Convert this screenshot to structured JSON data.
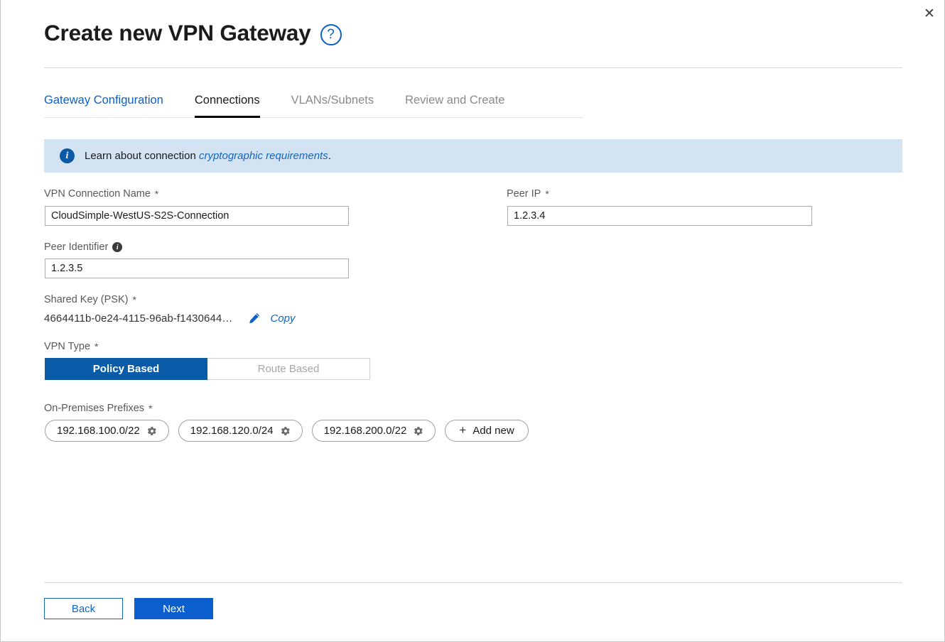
{
  "window": {
    "close_label": "✕"
  },
  "header": {
    "title": "Create new VPN Gateway",
    "help_glyph": "?"
  },
  "tabs": [
    {
      "label": "Gateway Configuration",
      "state": "link"
    },
    {
      "label": "Connections",
      "state": "active"
    },
    {
      "label": "VLANs/Subnets",
      "state": "muted"
    },
    {
      "label": "Review and Create",
      "state": "muted"
    }
  ],
  "banner": {
    "icon": "info-icon",
    "glyph": "i",
    "text": "Learn about connection ",
    "link_text": "cryptographic requirements",
    "trailing": "."
  },
  "form": {
    "connection_name": {
      "label": "VPN Connection Name",
      "required": "*",
      "value": "CloudSimple-WestUS-S2S-Connection",
      "placeholder": ""
    },
    "peer_ip": {
      "label": "Peer IP",
      "required": "*",
      "value": "1.2.3.4",
      "placeholder": ""
    },
    "peer_identifier": {
      "label": "Peer Identifier",
      "info_glyph": "i",
      "value": "1.2.3.5",
      "placeholder": ""
    },
    "shared_key": {
      "label": "Shared Key  (PSK)",
      "required": "*",
      "value": "4664411b-0e24-4115-96ab-f1430644…",
      "edit_icon": "pencil-icon",
      "copy_label": "Copy"
    },
    "vpn_type": {
      "label": "VPN Type",
      "required": "*",
      "options": [
        "Policy Based",
        "Route Based"
      ],
      "selected": "Policy Based"
    },
    "prefixes": {
      "label": "On-Premises Prefixes",
      "required": "*",
      "items": [
        {
          "value": "192.168.100.0/22",
          "icon": "gear-icon"
        },
        {
          "value": "192.168.120.0/24",
          "icon": "gear-icon"
        },
        {
          "value": "192.168.200.0/22",
          "icon": "gear-icon"
        }
      ],
      "add_label": "Add new",
      "add_glyph": "+"
    }
  },
  "footer": {
    "back_label": "Back",
    "next_label": "Next"
  },
  "colors": {
    "accent_blue": "#0a60c8",
    "primary_button": "#0a5ecd",
    "toggle_selected": "#0a5ba8",
    "banner_bg": "#d3e3f1",
    "muted_text": "#8a8a8a"
  }
}
